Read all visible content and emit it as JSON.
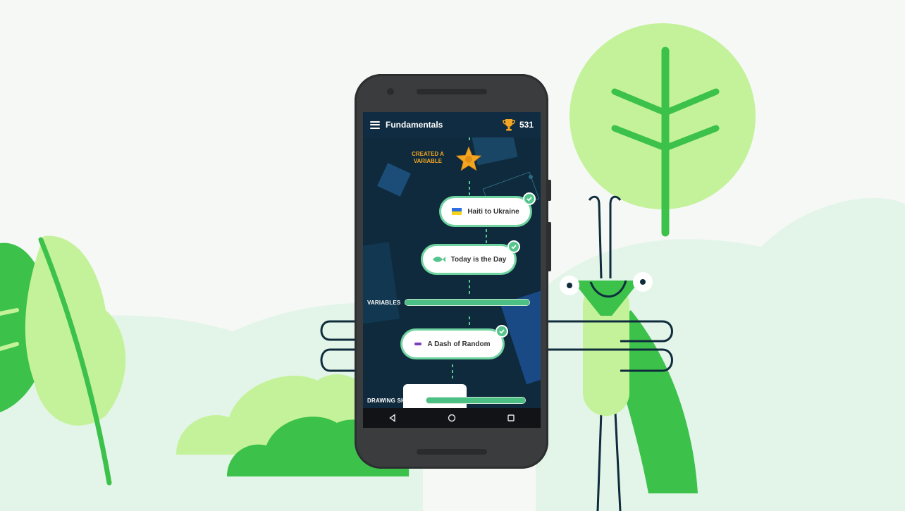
{
  "app": {
    "title": "Fundamentals",
    "score": "531"
  },
  "achievement": {
    "line1": "CREATED A",
    "line2": "VARIABLE",
    "icon": "star-icon"
  },
  "lessons": [
    {
      "label": "Haiti to Ukraine",
      "icon": "flag-icon",
      "completed": true
    },
    {
      "label": "Today is the Day",
      "icon": "fish-icon",
      "completed": true
    },
    {
      "label": "A Dash of Random",
      "icon": "dash-icon",
      "completed": true
    }
  ],
  "sections": [
    {
      "label": "VARIABLES",
      "progress": 1.0
    },
    {
      "label": "DRAWING SHAPES",
      "progress": 1.0
    }
  ],
  "navbar": {
    "back": "back-icon",
    "home": "home-icon",
    "recents": "recents-icon"
  },
  "colors": {
    "background": "#f6f8f6",
    "hill_light": "#e3f5e8",
    "leaf_light": "#c4f29a",
    "leaf_dark": "#3cc24a",
    "outline": "#0f2c3c",
    "screen": "#0e2a3c",
    "accent_gold": "#f4a623",
    "progress": "#4cbf84"
  }
}
